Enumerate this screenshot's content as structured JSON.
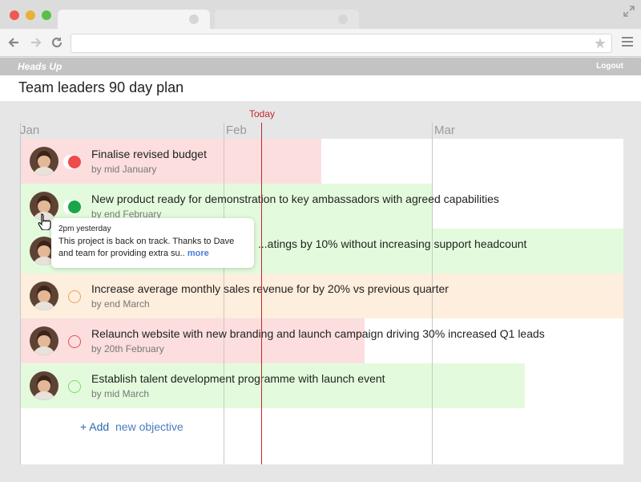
{
  "browser": {
    "icons": [
      "back-arrow-icon",
      "forward-arrow-icon",
      "reload-icon",
      "star-icon",
      "menu-icon",
      "expand-icon"
    ]
  },
  "app": {
    "name": "Heads Up",
    "logout_label": "Logout",
    "page_title": "Team leaders 90 day plan"
  },
  "timeline": {
    "months": [
      "Jan",
      "Feb",
      "Mar"
    ],
    "today_label": "Today"
  },
  "colors": {
    "red_bar": "#fcdede",
    "green_bar": "#e3fbdc",
    "orange_bar": "#fdeedd",
    "today_line": "#c0282d",
    "status_red": "#ee4b4b",
    "status_green": "#1aa54a",
    "link_blue": "#2b68b0"
  },
  "objectives": [
    {
      "title": "Finalise revised budget",
      "subtitle": "by mid January",
      "status": "red-filled"
    },
    {
      "title": "New product ready for demonstration to key ambassadors with agreed capabilities",
      "subtitle": "by end February",
      "status": "green-filled"
    },
    {
      "title": "...atings by 10% without increasing support headcount",
      "subtitle": "",
      "status": "hidden"
    },
    {
      "title": "Increase average monthly sales revenue for by 20% vs previous quarter",
      "subtitle": "by end March",
      "status": "orange-outline"
    },
    {
      "title": "Relaunch website with new branding and launch campaign driving 30% increased Q1 leads",
      "subtitle": "by 20th February",
      "status": "red-outline"
    },
    {
      "title": "Establish talent development programme with launch event",
      "subtitle": "by mid March",
      "status": "green-outline"
    }
  ],
  "add": {
    "button": "+ Add",
    "label": "new objective"
  },
  "tooltip": {
    "time": "2pm yesterday",
    "text": "This project is back on track. Thanks to Dave and team for providing extra su..",
    "more": "more"
  }
}
